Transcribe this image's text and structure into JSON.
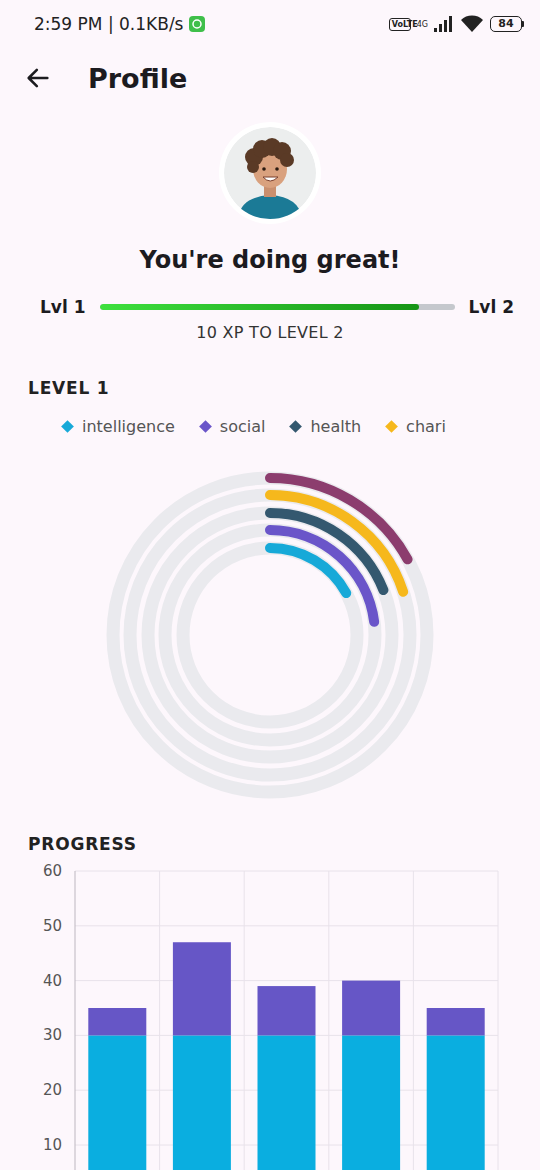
{
  "status_bar": {
    "time": "2:59 PM | 0.1KB/s",
    "volte": "VoLTE",
    "network": "4G",
    "battery": "84"
  },
  "app_bar": {
    "title": "Profile"
  },
  "header": {
    "message": "You're doing great!",
    "level_from": "Lvl 1",
    "level_to": "Lvl 2",
    "xp_level": 0.9,
    "xp_text": "10 XP TO LEVEL 2"
  },
  "level_chart": {
    "title": "LEVEL 1",
    "legend": [
      {
        "label": "intelligence",
        "color": "#17a9d8"
      },
      {
        "label": "social",
        "color": "#6a55c9"
      },
      {
        "label": "health",
        "color": "#34586f"
      },
      {
        "label": "chari",
        "color": "#f6b81c"
      }
    ],
    "max": 100,
    "rings": [
      {
        "value": 17,
        "color": "#17a9d8"
      },
      {
        "value": 23,
        "color": "#6a55c9"
      },
      {
        "value": 19,
        "color": "#34586f"
      },
      {
        "value": 20,
        "color": "#f6b81c"
      },
      {
        "value": 17,
        "color": "#8c3d6e"
      }
    ]
  },
  "progress_chart": {
    "title": "PROGRESS",
    "y_ticks": [
      "60",
      "50",
      "40",
      "30",
      "20",
      "10"
    ],
    "y_max": 60,
    "series": [
      {
        "color": "#0aaee0",
        "values": [
          30,
          30,
          30,
          30,
          30
        ]
      },
      {
        "color": "#6656c6",
        "values": [
          5,
          17,
          9,
          10,
          5
        ]
      }
    ]
  }
}
